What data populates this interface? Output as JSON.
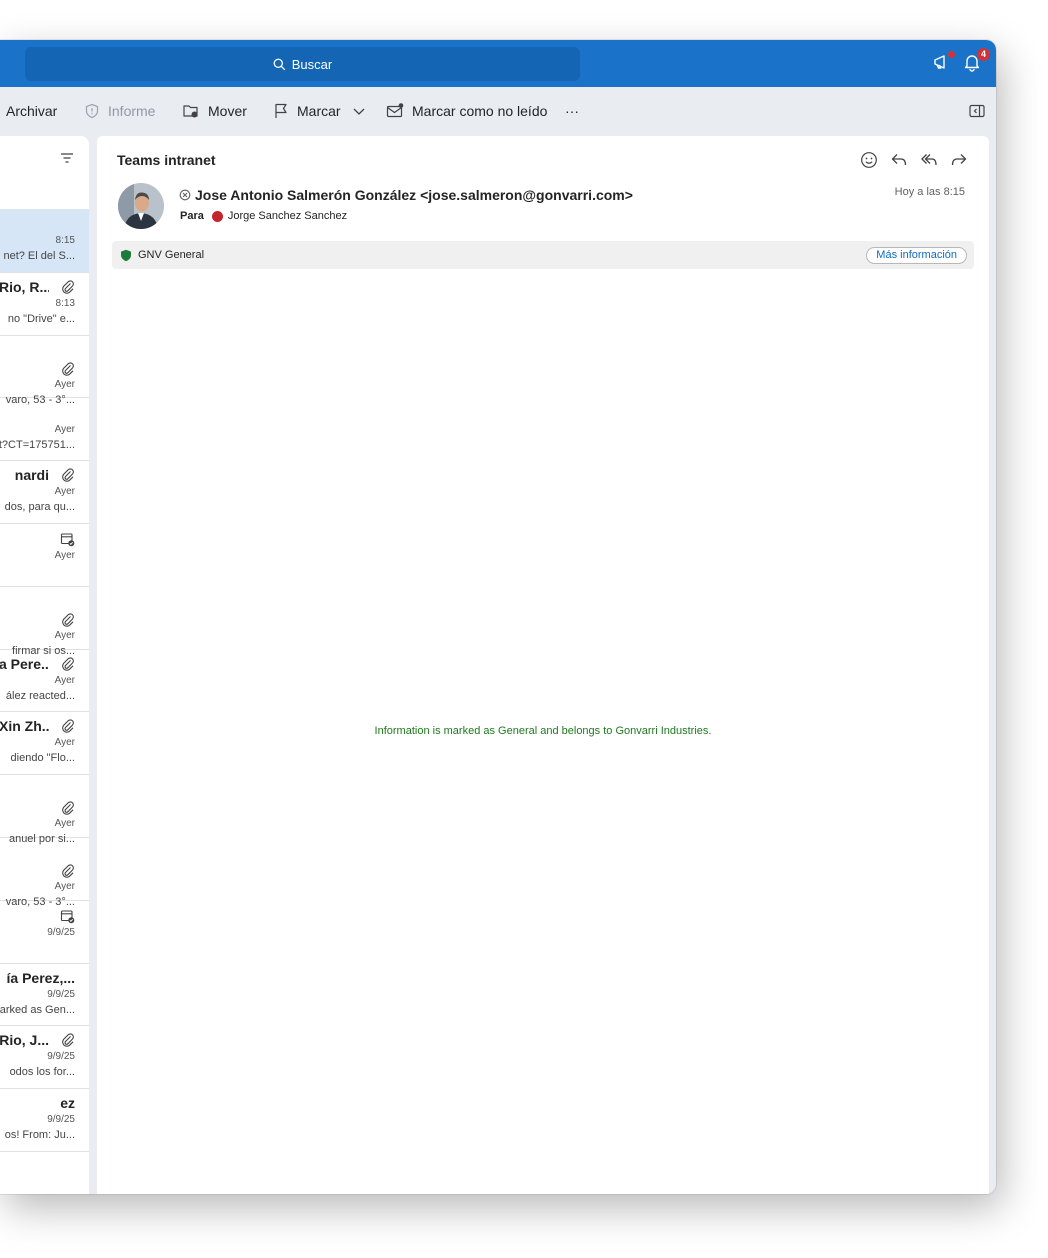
{
  "titlebar": {
    "search_placeholder": "Buscar",
    "notification_count": "4"
  },
  "toolbar": {
    "archive": "Archivar",
    "report": "Informe",
    "move": "Mover",
    "flag": "Marcar",
    "mark_unread": "Marcar como no leído",
    "more": "···"
  },
  "message_list": [
    {
      "sender": "",
      "time": "8:15",
      "preview": "net? El del S...",
      "selected": true,
      "icon": ""
    },
    {
      "sender": "Rio, R...",
      "time": "8:13",
      "preview": "no \"Drive\" e...",
      "icon": "paperclip-icon"
    },
    {
      "sender": "",
      "time": "Ayer",
      "preview": "varo, 53 - 3°...",
      "icon": "paperclip-icon"
    },
    {
      "sender": "",
      "time": "Ayer",
      "preview": "t?CT=175751...",
      "icon": ""
    },
    {
      "sender": "nardi",
      "time": "Ayer",
      "preview": "dos, para qu...",
      "icon": "paperclip-icon"
    },
    {
      "sender": "",
      "time": "Ayer",
      "preview": "",
      "icon": "calendar-icon"
    },
    {
      "sender": "",
      "time": "Ayer",
      "preview": "firmar si os...",
      "icon": "paperclip-icon"
    },
    {
      "sender": "a Pere...",
      "time": "Ayer",
      "preview": "ález reacted...",
      "icon": "paperclip-icon"
    },
    {
      "sender": "Xin Zh...",
      "time": "Ayer",
      "preview": "diendo \"Flo...",
      "icon": "paperclip-icon"
    },
    {
      "sender": "",
      "time": "Ayer",
      "preview": "anuel por si...",
      "icon": "paperclip-icon"
    },
    {
      "sender": "",
      "time": "Ayer",
      "preview": "varo, 53 - 3°...",
      "icon": "paperclip-icon"
    },
    {
      "sender": "",
      "time": "9/9/25",
      "preview": "",
      "icon": "calendar-icon"
    },
    {
      "sender": "ía Perez,...",
      "time": "9/9/25",
      "preview": "arked as Gen...",
      "icon": ""
    },
    {
      "sender": "Rio, J...",
      "time": "9/9/25",
      "preview": "odos los for...",
      "icon": "paperclip-icon"
    },
    {
      "sender": "ez",
      "time": "9/9/25",
      "preview": "os! From: Ju...",
      "icon": ""
    }
  ],
  "reading": {
    "subject": "Teams intranet",
    "from": "Jose Antonio Salmerón González <jose.salmeron@gonvarri.com>",
    "date": "Hoy a las 8:15",
    "to_label": "Para",
    "to_name": "Jorge Sanchez Sanchez",
    "sensitivity_label": "GNV General",
    "more_info": "Más información",
    "body_note": "Information is marked as General and belongs to Gonvarri Industries."
  },
  "colors": {
    "titlebar": "#1a73c8",
    "search_box": "#1466b5",
    "selected_row": "#d6e6f7",
    "presence_busy": "#c4262e",
    "sensitivity_green": "#1e7a3c",
    "body_note_green": "#1e7a1e",
    "link_blue": "#0f6cbd"
  }
}
